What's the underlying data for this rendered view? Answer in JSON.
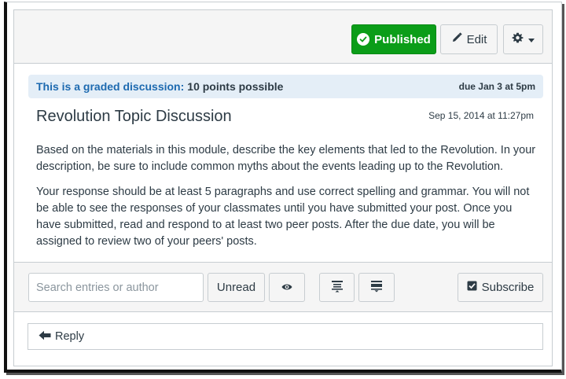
{
  "toolbar": {
    "published_label": "Published",
    "edit_label": "Edit"
  },
  "discussion": {
    "graded_text": "This is a graded discussion:",
    "points_text": "10 points possible",
    "due_text": "due Jan 3 at 5pm",
    "title": "Revolution Topic Discussion",
    "timestamp": "Sep 15, 2014 at 11:27pm",
    "paragraphs": [
      "Based on the materials in this module, describe the key elements that led to the Revolution. In your description, be sure to include common myths about the events leading up to the Revolution.",
      "Your response should be at least 5 paragraphs and use correct spelling and grammar. You will not be able to see the responses of your classmates until you have submitted your post. Once you have submitted, read and respond to at least two peer posts. After the due date, you will be assigned to review two of your peers' posts."
    ]
  },
  "filters": {
    "search_placeholder": "Search entries or author",
    "unread_label": "Unread",
    "subscribe_label": "Subscribe"
  },
  "reply": {
    "label": "Reply"
  },
  "colors": {
    "published_green": "#0b9d18",
    "link_blue": "#1d6ab0",
    "info_bg": "#e4eef7"
  }
}
